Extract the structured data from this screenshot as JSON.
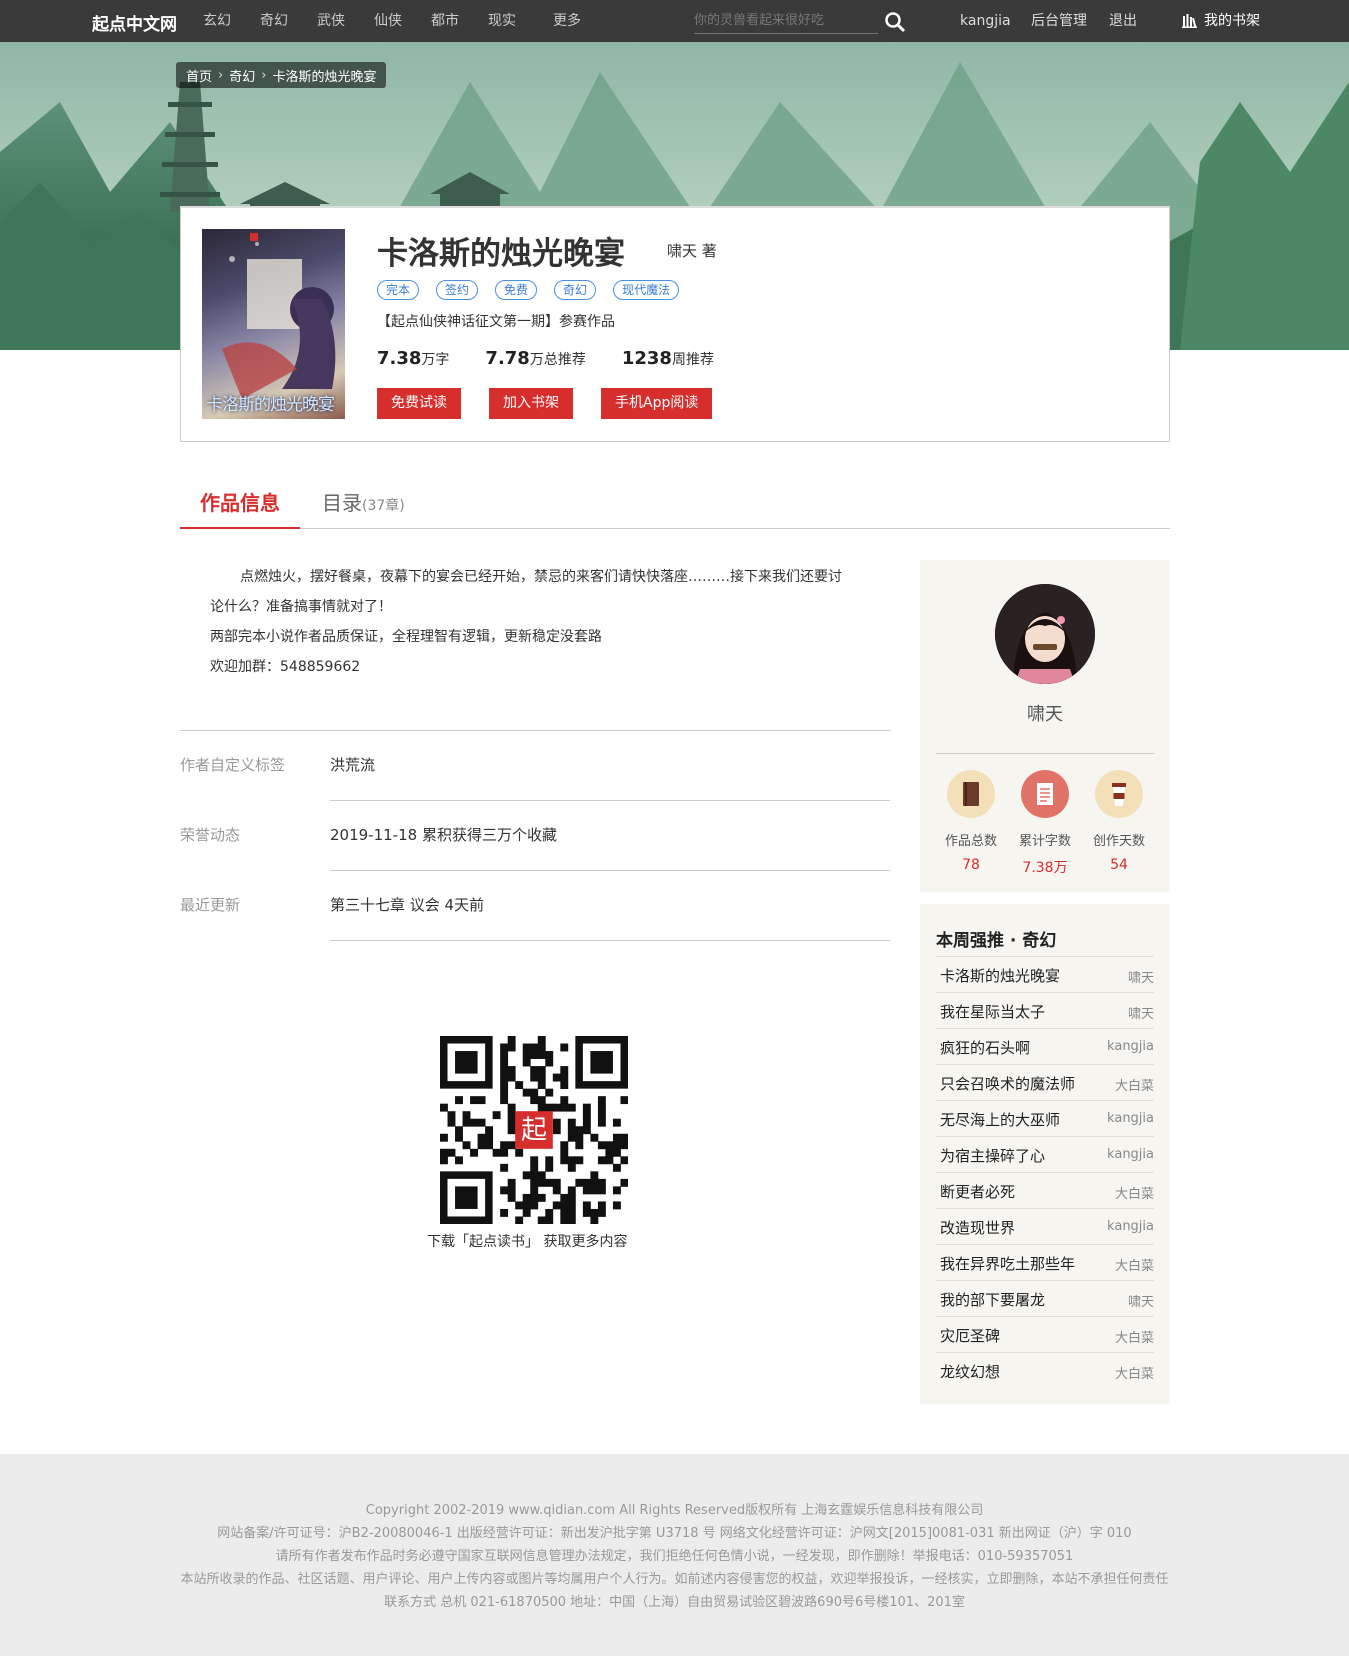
{
  "header": {
    "brand": "起点中文网",
    "nav": [
      "玄幻",
      "奇幻",
      "武侠",
      "仙侠",
      "都市",
      "现实",
      "更多"
    ],
    "search_placeholder": "你的灵兽看起来很好吃",
    "user": "kangjia",
    "admin": "后台管理",
    "logout": "退出",
    "bookshelf": "我的书架"
  },
  "breadcrumb": {
    "home": "首页",
    "category": "奇幻",
    "book": "卡洛斯的烛光晚宴"
  },
  "book": {
    "title": "卡洛斯的烛光晚宴",
    "author_line": "啸天 著",
    "cover_title": "卡洛斯的烛光晚宴",
    "tags": [
      "完本",
      "签约",
      "免费",
      "奇幻",
      "现代魔法"
    ],
    "slogan": "【起点仙侠神话征文第一期】参赛作品",
    "words_num": "7.38",
    "words_unit": "万字",
    "total_rec_num": "7.78",
    "total_rec_unit": "万总推荐",
    "week_rec_num": "1238",
    "week_rec_unit": "周推荐",
    "buttons": {
      "read": "免费试读",
      "add": "加入书架",
      "app": "手机App阅读"
    }
  },
  "tabs": {
    "info": "作品信息",
    "catalog": "目录",
    "catalog_count": "(37章)"
  },
  "intro": [
    "点燃烛火，摆好餐桌，夜幕下的宴会已经开始，禁忌的来客们请快快落座………接下来我们还要讨",
    "论什么？准备搞事情就对了！",
    "两部完本小说作者品质保证，全程理智有逻辑，更新稳定没套路",
    "欢迎加群：548859662"
  ],
  "details": [
    {
      "key": "作者自定义标签",
      "value": "洪荒流"
    },
    {
      "key": "荣誉动态",
      "value": "2019-11-18  累积获得三万个收藏"
    },
    {
      "key": "最近更新",
      "value": "第三十七章 议会      4天前"
    }
  ],
  "qr_caption": "下载「起点读书」 获取更多内容",
  "author_panel": {
    "name": "啸天",
    "stats": [
      {
        "label": "作品总数",
        "value": "78",
        "color": "#f3dfb8"
      },
      {
        "label": "累计字数",
        "value": "7.38万",
        "color": "#e07268"
      },
      {
        "label": "创作天数",
        "value": "54",
        "color": "#f3dfb8"
      }
    ]
  },
  "ranking": {
    "title": "本周强推 · 奇幻",
    "items": [
      {
        "book": "卡洛斯的烛光晚宴",
        "author": "啸天"
      },
      {
        "book": "我在星际当太子",
        "author": "啸天"
      },
      {
        "book": "疯狂的石头啊",
        "author": "kangjia"
      },
      {
        "book": "只会召唤术的魔法师",
        "author": "大白菜"
      },
      {
        "book": "无尽海上的大巫师",
        "author": "kangjia"
      },
      {
        "book": "为宿主操碎了心",
        "author": "kangjia"
      },
      {
        "book": "断更者必死",
        "author": "大白菜"
      },
      {
        "book": "改造现世界",
        "author": "kangjia"
      },
      {
        "book": "我在异界吃土那些年",
        "author": "大白菜"
      },
      {
        "book": "我的部下要屠龙",
        "author": "啸天"
      },
      {
        "book": "灾厄圣碑",
        "author": "大白菜"
      },
      {
        "book": "龙纹幻想",
        "author": "大白菜"
      }
    ]
  },
  "footer": [
    "Copyright   2002-2019 www.qidian.com All Rights Reserved版权所有 上海玄霆娱乐信息科技有限公司",
    "网站备案/许可证号：沪B2-20080046-1 出版经营许可证：新出发沪批字第 U3718 号 网络文化经营许可证：沪网文[2015]0081-031 新出网证（沪）字 010",
    "请所有作者发布作品时务必遵守国家互联网信息管理办法规定，我们拒绝任何色情小说，一经发现，即作删除！举报电话：010-59357051",
    "本站所收录的作品、社区话题、用户评论、用户上传内容或图片等均属用户个人行为。如前述内容侵害您的权益，欢迎举报投诉，一经核实，立即删除，本站不承担任何责任",
    "联系方式 总机 021-61870500 地址：中国（上海）自由贸易试验区碧波路690号6号楼101、201室"
  ]
}
